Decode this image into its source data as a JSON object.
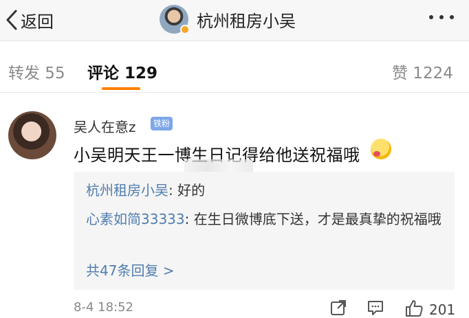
{
  "nav": {
    "back_label": "返回",
    "title": "杭州租房小吴"
  },
  "tabs": [
    {
      "label": "转发 55"
    },
    {
      "label": "评论 129"
    },
    {
      "label": "赞 1224"
    }
  ],
  "comment": {
    "username": "吴人在意z",
    "badge": "铁粉",
    "content": "小吴明天王一博生日记得给他送祝福哦",
    "replies": [
      {
        "author": "杭州租房小吴",
        "text": ": 好的"
      },
      {
        "author": "心素如简33333",
        "text": ": 在生日微博底下送，才是最真挚的祝福哦"
      }
    ],
    "more_replies": "共47条回复 >",
    "time": "8-4 18:52",
    "like_count": "201"
  },
  "colors": {
    "accent": "#ff8200",
    "link": "#507daf",
    "badge": "#7ea7e8"
  }
}
